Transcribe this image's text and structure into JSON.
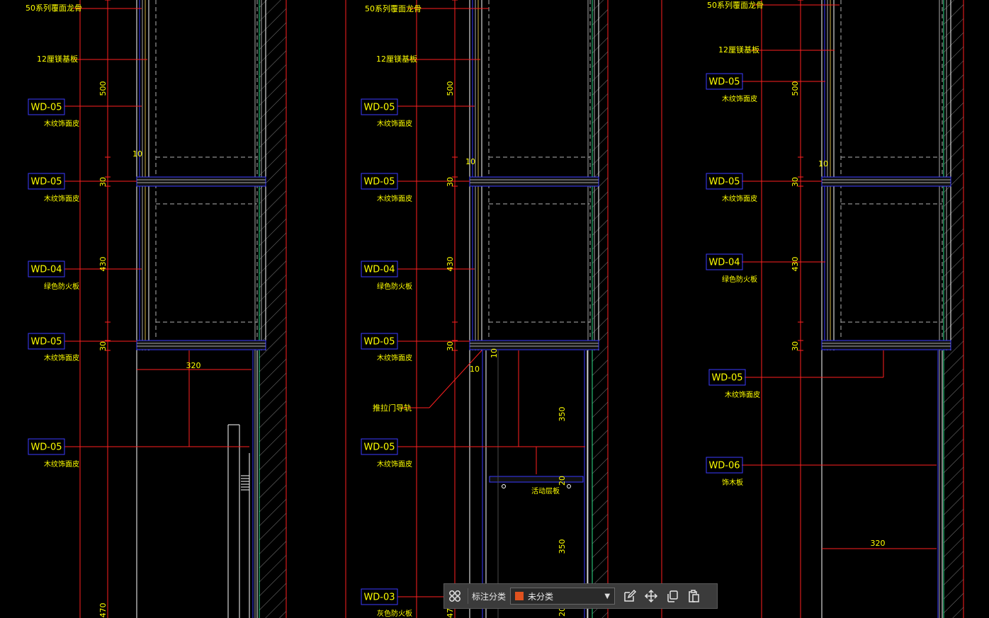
{
  "colors": {
    "background": "#000000",
    "annotation_text": "#ffff00",
    "tag_border": "#3b3bff",
    "leader_line": "#ff2020",
    "cabinet_line": "#ffffff",
    "panel_inner": "#3a3aff",
    "wall_line": "#2ee08a",
    "hatch": "#aaaaaa",
    "category_swatch": "#e0521f"
  },
  "drawing": {
    "columns": [
      {
        "labels": [
          {
            "text": "50系列覆面龙骨"
          },
          {
            "text": "12厘镁基板"
          },
          {
            "tag": "WD-05",
            "text": "木纹饰面皮"
          },
          {
            "tag": "WD-05",
            "text": "木纹饰面皮"
          },
          {
            "tag": "WD-04",
            "text": "绿色防火板"
          },
          {
            "tag": "WD-05",
            "text": "木纹饰面皮"
          },
          {
            "tag": "WD-05",
            "text": "木纹饰面皮"
          }
        ],
        "dimensions": [
          "500",
          "10",
          "30",
          "430",
          "30",
          "320",
          "470"
        ]
      },
      {
        "labels": [
          {
            "text": "50系列覆面龙骨"
          },
          {
            "text": "12厘镁基板"
          },
          {
            "tag": "WD-05",
            "text": "木纹饰面皮"
          },
          {
            "tag": "WD-05",
            "text": "木纹饰面皮"
          },
          {
            "tag": "WD-04",
            "text": "绿色防火板"
          },
          {
            "tag": "WD-05",
            "text": "木纹饰面皮"
          },
          {
            "text": "推拉门导轨"
          },
          {
            "tag": "WD-05",
            "text": "木纹饰面皮"
          },
          {
            "tag": "WD-03",
            "text": "灰色防火板"
          }
        ],
        "dimensions": [
          "500",
          "10",
          "30",
          "430",
          "30",
          "10",
          "10",
          "350",
          "20",
          "350",
          "20",
          "47"
        ],
        "shelf_label": "活动层板"
      },
      {
        "labels": [
          {
            "text": "50系列覆面龙骨"
          },
          {
            "text": "12厘镁基板"
          },
          {
            "tag": "WD-05",
            "text": "木纹饰面皮"
          },
          {
            "tag": "WD-05",
            "text": "木纹饰面皮"
          },
          {
            "tag": "WD-04",
            "text": "绿色防火板"
          },
          {
            "tag": "WD-05",
            "text": "木纹饰面皮"
          },
          {
            "tag": "WD-06",
            "text": "饰木板"
          }
        ],
        "dimensions": [
          "500",
          "10",
          "30",
          "430",
          "30",
          "320"
        ]
      }
    ]
  },
  "toolbar": {
    "grid_icon": "grid-icon",
    "category_label": "标注分类",
    "category_value": "未分类",
    "edit_icon": "edit-icon",
    "move_icon": "move-icon",
    "copy_icon": "copy-icon",
    "paste_icon": "paste-icon"
  }
}
